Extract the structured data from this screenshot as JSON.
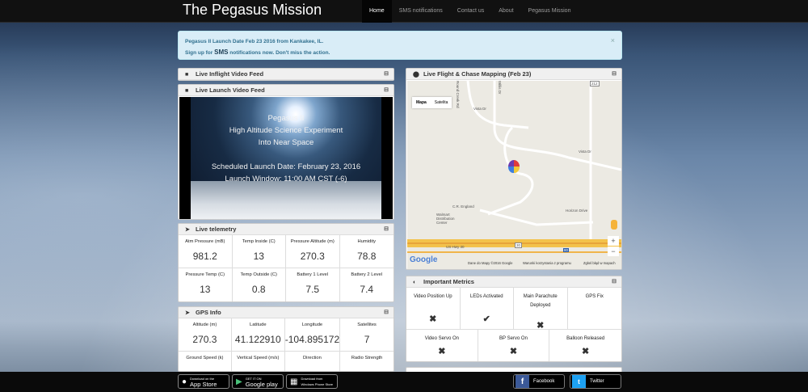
{
  "nav": {
    "brand": "The Pegasus Mission",
    "links": [
      "Home",
      "SMS notifications",
      "Contact us",
      "About",
      "Pegasus Mission"
    ]
  },
  "alert": {
    "line1": "Pegasus II Launch Date Feb 23 2016 from Kankakee, IL.",
    "line2_pre": "Sign up for ",
    "line2_sms": "SMS",
    "line2_post": " notifications now. Don't miss the action.",
    "close": "×"
  },
  "panels": {
    "inflight": {
      "title": "Live Inflight Video Feed",
      "toggle": "⊟"
    },
    "launch": {
      "title": "Live Launch Video Feed",
      "toggle": "⊟",
      "video_lines": [
        "Pegasus II",
        "High Altitude Science Experiment",
        "Into Near Space",
        "Scheduled Launch Date: February 23, 2016",
        "Launch Window:  11:00 AM CST (-6)"
      ]
    },
    "telemetry": {
      "title": "Live telemetry",
      "toggle": "⊟",
      "cells": [
        {
          "label": "Atm Pressure (mB)",
          "value": "981.2"
        },
        {
          "label": "Temp Inside (C)",
          "value": "13"
        },
        {
          "label": "Pressure Altitude (m)",
          "value": "270.3"
        },
        {
          "label": "Humidity",
          "value": "78.8"
        },
        {
          "label": "Pressure Temp (C)",
          "value": "13"
        },
        {
          "label": "Temp Outside (C)",
          "value": "0.8"
        },
        {
          "label": "Battery 1 Level",
          "value": "7.5"
        },
        {
          "label": "Battery 2 Level",
          "value": "7.4"
        }
      ]
    },
    "gps": {
      "title": "GPS Info",
      "toggle": "⊟",
      "cells": [
        {
          "label": "Altitude (m)",
          "value": "270.3"
        },
        {
          "label": "Latitude",
          "value": "41.122910"
        },
        {
          "label": "Longitude",
          "value": "-104.895172"
        },
        {
          "label": "Satellites",
          "value": "7"
        },
        {
          "label": "Ground Speed (k)",
          "value": ""
        },
        {
          "label": "Vertical Speed (m/s)",
          "value": ""
        },
        {
          "label": "Direction",
          "value": ""
        },
        {
          "label": "Radio Strength",
          "value": ""
        }
      ]
    },
    "map": {
      "title": "Live Flight & Chase Mapping (Feb 23)",
      "toggle": "⊟",
      "controls": [
        "Mapa",
        "Satelita"
      ],
      "labels": {
        "road1": "Round Creek Rd",
        "road2": "Willis Dr",
        "road3": "Vista Dr",
        "road4": "Vista Dr",
        "place1": "C.R. England",
        "place2": "Walmart\nDistribution Center",
        "road5": "Horizon Drive",
        "highway": "US Hwy 30",
        "shield1": "30",
        "shield2": "80",
        "shield3": "212"
      },
      "zoom_in": "+",
      "zoom_out": "−",
      "google": "Google",
      "footer": [
        "Dane do Mapy ©2016 Google",
        "Warunki korzystania z programu",
        "Zgłoś błąd w mapach"
      ]
    },
    "metrics": {
      "title": "Important Metrics",
      "toggle": "⊟",
      "row1": [
        {
          "label": "Video Position Up",
          "mark": "✖"
        },
        {
          "label": "LEDs Activated",
          "mark": "✔"
        },
        {
          "label": "Main Parachute Deployed",
          "mark": "✖"
        },
        {
          "label": "GPS Fix",
          "mark": ""
        }
      ],
      "row2": [
        {
          "label": "Video Servo On",
          "mark": "✖"
        },
        {
          "label": "BP Servo On",
          "mark": "✖"
        },
        {
          "label": "Balloon Released",
          "mark": "✖"
        }
      ]
    }
  },
  "footer": {
    "appstore_small": "Download on the",
    "appstore_big": "App Store",
    "googleplay_small": "GET IT ON",
    "googleplay_big": "Google play",
    "winphone_small": "Download from",
    "winphone_big": "Windows Phone Store",
    "facebook": "Facebook",
    "twitter": "Twitter"
  },
  "colors": {
    "alert_bg": "#d9edf7",
    "alert_text": "#31708f",
    "navbar": "#111111",
    "facebook": "#3b5998",
    "twitter": "#1da1f2"
  }
}
